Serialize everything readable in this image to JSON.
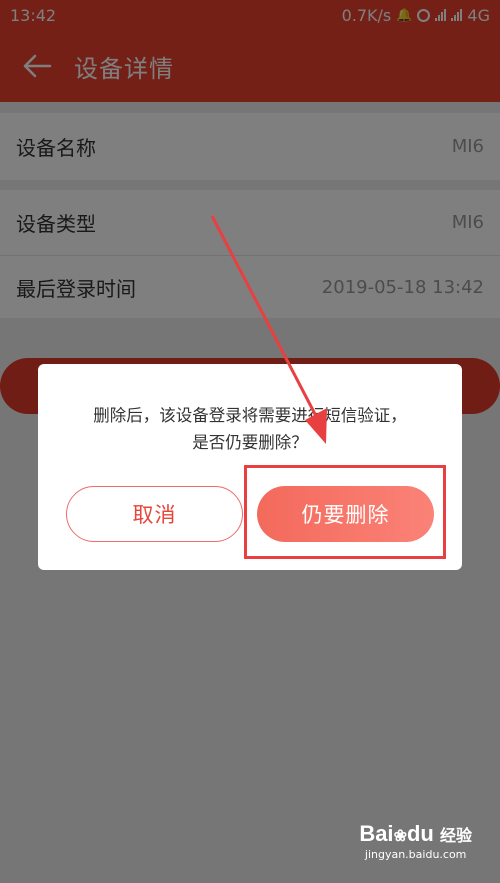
{
  "status_bar": {
    "time": "13:42",
    "net_speed": "0.7K/s",
    "network": "4G"
  },
  "app_bar": {
    "back_icon": "arrow-left-icon",
    "title": "设备详情"
  },
  "details": [
    {
      "label": "设备名称",
      "value": "MI6"
    },
    {
      "label": "设备类型",
      "value": "MI6"
    },
    {
      "label": "最后登录时间",
      "value": "2019-05-18 13:42"
    }
  ],
  "dialog": {
    "message_line1": "删除后，该设备登录将需要进行短信验证，",
    "message_line2": "是否仍要删除？",
    "cancel_label": "取消",
    "confirm_label": "仍要删除"
  },
  "watermark": {
    "brand": "Bai",
    "brand2": "du",
    "brand_cn": "经验",
    "url": "jingyan.baidu.com"
  },
  "colors": {
    "primary": "#e8402f",
    "confirm_gradient_start": "#f36a5c",
    "confirm_gradient_end": "#fb8277",
    "annotation": "#e84040"
  }
}
